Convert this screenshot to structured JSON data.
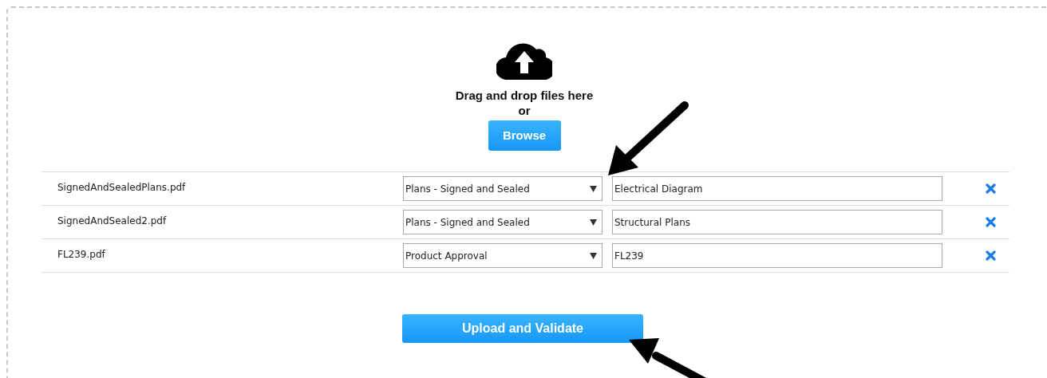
{
  "dropzone": {
    "prompt": "Drag and drop files here",
    "separator": "or",
    "browse_button": "Browse"
  },
  "files": [
    {
      "name": "SignedAndSealedPlans.pdf",
      "category": "Plans - Signed and Sealed",
      "description": "Electrical Diagram"
    },
    {
      "name": "SignedAndSealed2.pdf",
      "category": "Plans - Signed and Sealed",
      "description": "Structural Plans"
    },
    {
      "name": "FL239.pdf",
      "category": "Product Approval",
      "description": "FL239"
    }
  ],
  "submit_button": "Upload and Validate"
}
